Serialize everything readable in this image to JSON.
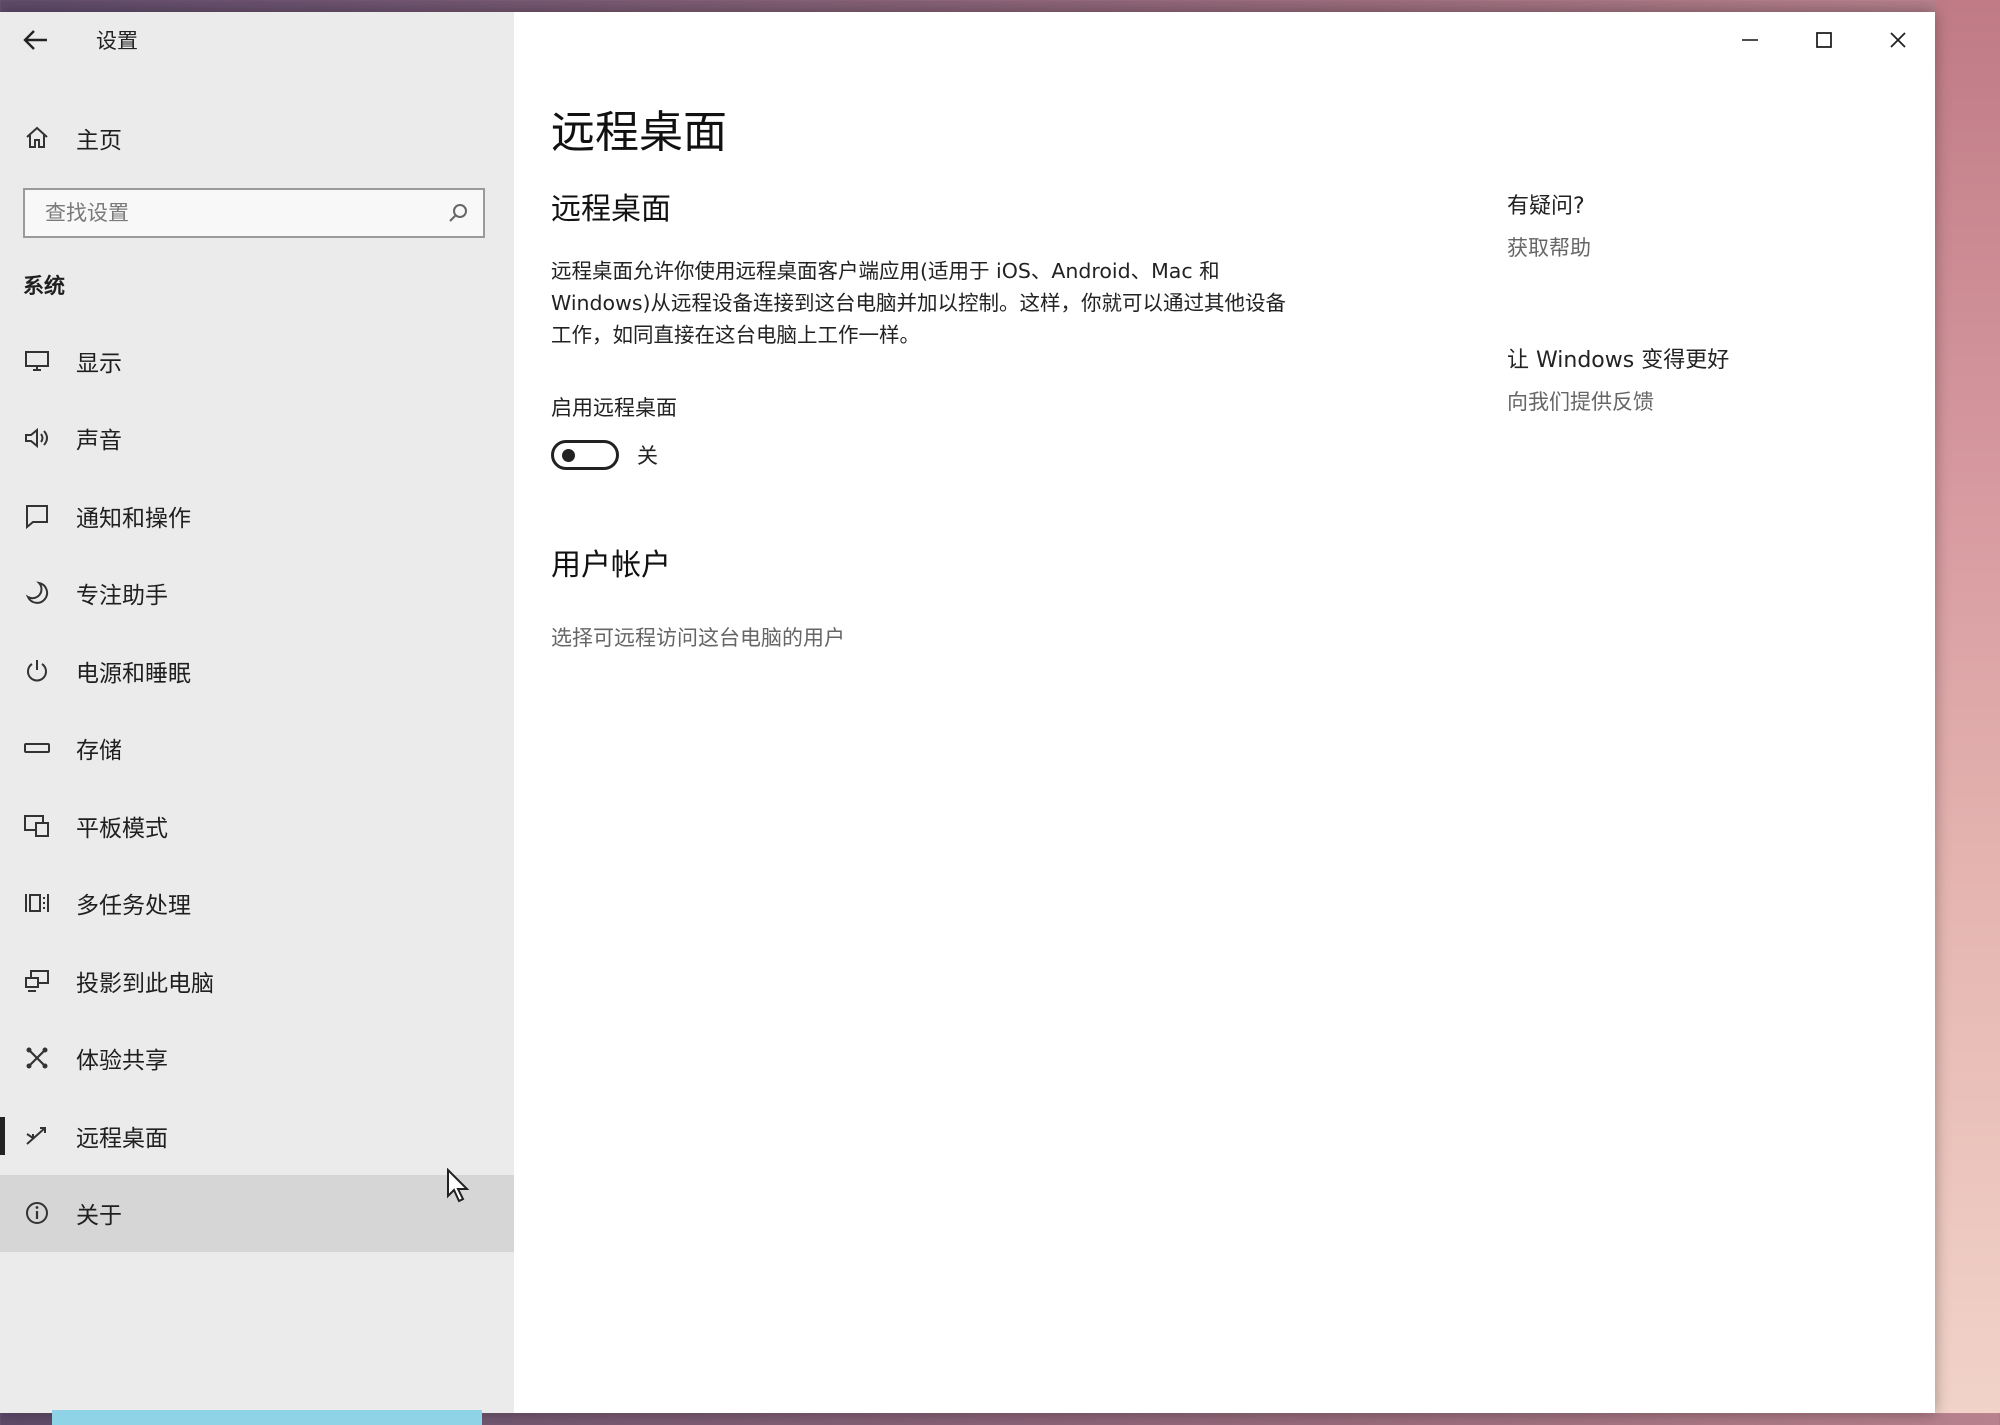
{
  "window": {
    "title": "设置",
    "controls": {
      "minimize": "minimize",
      "maximize": "maximize",
      "close": "close"
    }
  },
  "sidebar": {
    "home_label": "主页",
    "search_placeholder": "查找设置",
    "section_title": "系统",
    "items": [
      {
        "label": "显示",
        "icon": "monitor-icon"
      },
      {
        "label": "声音",
        "icon": "speaker-icon"
      },
      {
        "label": "通知和操作",
        "icon": "notification-icon"
      },
      {
        "label": "专注助手",
        "icon": "moon-icon"
      },
      {
        "label": "电源和睡眠",
        "icon": "power-icon"
      },
      {
        "label": "存储",
        "icon": "storage-icon"
      },
      {
        "label": "平板模式",
        "icon": "tablet-mode-icon"
      },
      {
        "label": "多任务处理",
        "icon": "multitasking-icon"
      },
      {
        "label": "投影到此电脑",
        "icon": "projecting-icon"
      },
      {
        "label": "体验共享",
        "icon": "shared-experiences-icon"
      },
      {
        "label": "远程桌面",
        "icon": "remote-desktop-icon",
        "selected": true
      },
      {
        "label": "关于",
        "icon": "info-icon",
        "hover": true
      }
    ]
  },
  "main": {
    "page_title": "远程桌面",
    "section_title": "远程桌面",
    "description": "远程桌面允许你使用远程桌面客户端应用(适用于 iOS、Android、Mac 和 Windows)从远程设备连接到这台电脑并加以控制。这样，你就可以通过其他设备工作，如同直接在这台电脑上工作一样。",
    "toggle_label": "启用远程桌面",
    "toggle_state": "关",
    "toggle_on": false,
    "users_title": "用户帐户",
    "users_link": "选择可远程访问这台电脑的用户"
  },
  "aside": {
    "question_title": "有疑问?",
    "help_link": "获取帮助",
    "improve_title": "让 Windows 变得更好",
    "feedback_link": "向我们提供反馈"
  },
  "colors": {
    "sidebar_bg": "#ebebeb",
    "hover_bg": "#d6d6d6",
    "text": "#1f1f1f",
    "link": "#666666"
  }
}
